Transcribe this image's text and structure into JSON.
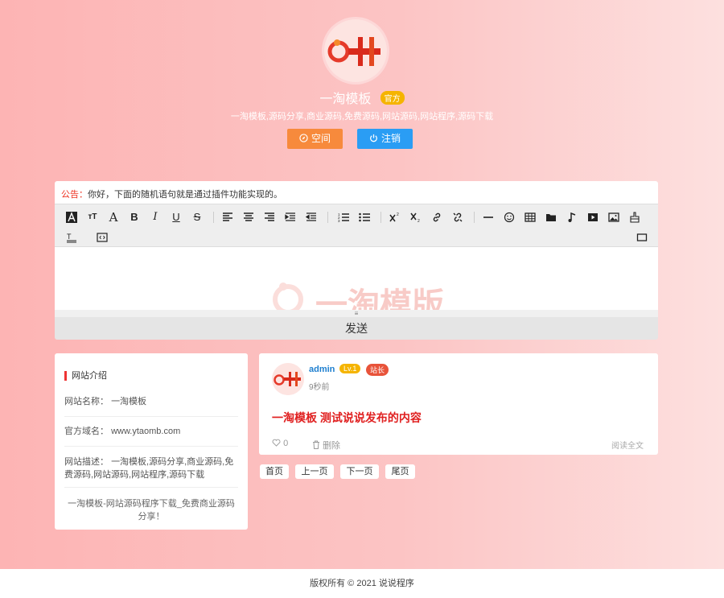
{
  "header": {
    "site_name": "一淘模板",
    "badge": "官方",
    "description": "一淘模板,源码分享,商业源码,免费源码,网站源码,网站程序,源码下载",
    "space_label": "空间",
    "logout_label": "注销"
  },
  "notice": {
    "label": "公告：",
    "text": "你好，下面的随机语句就是通过插件功能实现的。"
  },
  "editor": {
    "watermark": "一淘模版",
    "send_label": "发送",
    "resize_glyph": "≡"
  },
  "sidebar": {
    "title": "网站介绍",
    "site_name_label": "网站名称：",
    "site_name_value": "一淘模板",
    "domain_label": "官方域名：",
    "domain_value": "www.ytaomb.com",
    "desc_label": "网站描述：",
    "desc_value": "一淘模板,源码分享,商业源码,免费源码,网站源码,网站程序,源码下载",
    "footer": "一淘模板-网站源码程序下载_免费商业源码分享！"
  },
  "post": {
    "user": "admin",
    "level": "Lv.1",
    "role": "站长",
    "time": "9秒前",
    "content": "一淘模板 测试说说发布的内容",
    "likes": "0",
    "delete_label": "删除",
    "read_more": "阅读全文"
  },
  "pager": {
    "first": "首页",
    "prev": "上一页",
    "next": "下一页",
    "last": "尾页"
  },
  "footer": {
    "copyright": "版权所有 © 2021 说说程序"
  },
  "colors": {
    "accent_orange": "#f78a3c",
    "accent_blue": "#2a9df4",
    "badge_yellow": "#f5b400",
    "badge_red": "#e8533a",
    "post_text": "#e02020"
  }
}
